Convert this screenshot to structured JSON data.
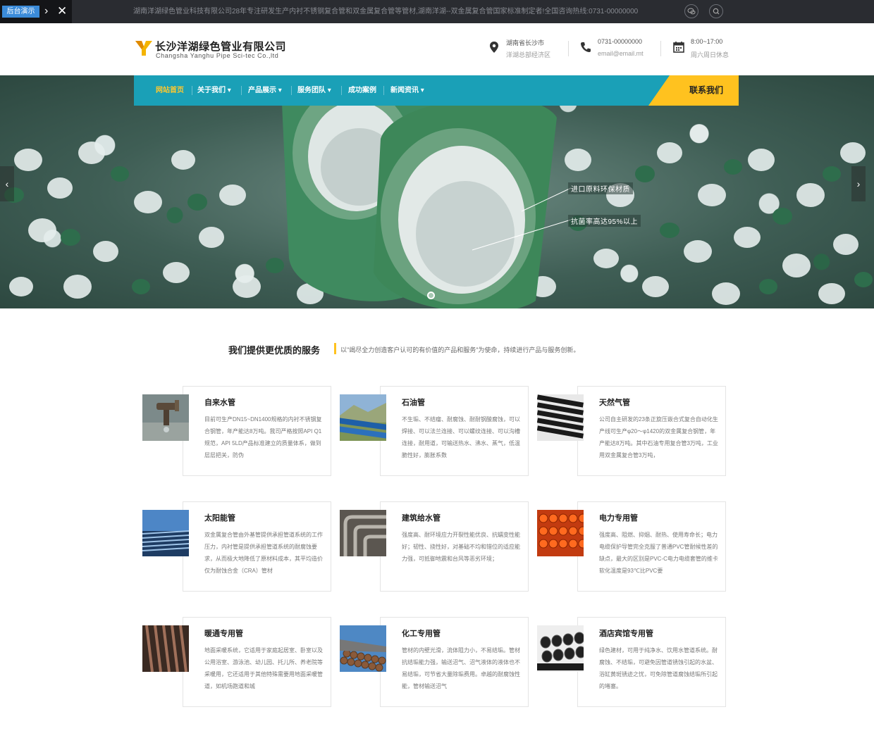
{
  "topbar": {
    "admin_label": "后台演示",
    "marquee": "湖南洋湖绿色管业科技有限公司28年专注研发生产内衬不锈钢复合管和双金属复合管等管材,湖南洋湖--双金属复合管国家标准制定者!全国咨询热线:0731-00000000"
  },
  "header": {
    "logo_cn": "长沙洋湖绿色管业有限公司",
    "logo_en": "Changsha Yanghu Pipe Sci-tec Co.,ltd",
    "address_line1": "湖南省长沙市",
    "address_line2": "洋湖总部经济区",
    "phone": "0731-00000000",
    "email": "email@email.mt",
    "hours": "8:00~17:00",
    "days": "周六周日休息"
  },
  "nav": {
    "items": [
      {
        "label": "网站首页"
      },
      {
        "label": "关于我们 ▾"
      },
      {
        "label": "产品展示 ▾"
      },
      {
        "label": "服务团队 ▾"
      },
      {
        "label": "成功案例"
      },
      {
        "label": "新闻资讯 ▾"
      }
    ],
    "contact_label": "联系我们"
  },
  "banner": {
    "callout1": "进口原料环保材质",
    "callout2": "抗菌率高达95%以上"
  },
  "section": {
    "title": "我们提供更优质的服务",
    "subtitle": "以\"竭尽全力创造客户认可的有价值的产品和服务\"为使命，持续进行产品与服务创新。"
  },
  "cards": [
    {
      "title": "自来水管",
      "desc": "目前可生产DN15~DN1400规格的内衬不锈钢复合钢管，年产能达8万吨。我司严格按照API Q1规范，API 5LD产品标准建立的质量体系，做到层层把关，防伪"
    },
    {
      "title": "石油管",
      "desc": "不生垢、不结瘤、耐腐蚀、耐耐钢酸腐蚀，可以焊接、可以法兰连接、可以螺纹连接、可以沟槽连接，耐用道，可输送热水、沸水、蒸气，低温脆性好，膨胀系数"
    },
    {
      "title": "天然气管",
      "desc": "公司自主研发的23条正旋压嵌合式复合自动化生产线可生产φ20～φ1420的双金属复合钢管，年产能达8万吨。其中石油专用复合管3万吨，工业用双金属复合管3万吨，"
    },
    {
      "title": "太阳能管",
      "desc": "双金属复合管由外基管提供承担管道系统的工作压力，内衬管是提供承担管道系统的耐腐蚀要求，从而极大地降低了原材料成本，其平均造价仅为耐蚀合金（CRA）管材"
    },
    {
      "title": "建筑给水管",
      "desc": "强度高、耐环境应力开裂性能优良、抗蠕变性能好；韧性、挠性好，对基础不均和错位的适应能力强，可抵御地震和台风等恶劣环境；"
    },
    {
      "title": "电力专用管",
      "desc": "强度高、阻燃、抑烟、耐热、使用寿命长；电力电缆保护导管完全克服了普通PVC管耐候性差的缺点，最大的区别是PVC-C电力电缆套管的维卡软化温度是93℃比PVC要"
    },
    {
      "title": "暖通专用管",
      "desc": "地面采暖系统，它适用于家庭起居室、卧室以及公用浴室、游泳池、幼儿园、托儿所、养老院等采暖用，它还适用于其他特殊需要用地面采暖管道，如机场跑道和城"
    },
    {
      "title": "化工专用管",
      "desc": "管材的内壁光滑，流体阻力小，不易结垢。管材抗结垢能力强，输送沼气、沼气液体的液体也不易结垢，可节省大量除垢费用。卓越的耐腐蚀性能，管材输送沼气"
    },
    {
      "title": "酒店宾馆专用管",
      "desc": "绿色建材，可用于纯净水、饮用水管道系统。耐腐蚀、不结垢，可避免因管道锈蚀引起的水盆、浴缸黄斑锈迹之忧，可免除管道腐蚀结垢所引起的堵塞。"
    }
  ],
  "colors": {
    "nav_bg": "#1aa0b7",
    "accent": "#ffc21f",
    "topbar_bg": "#2a2c31"
  }
}
